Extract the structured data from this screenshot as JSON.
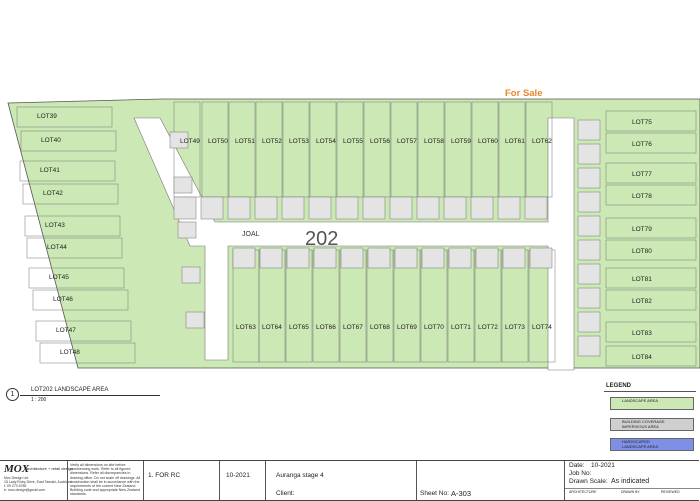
{
  "sale_label": "For Sale",
  "site_number": "202",
  "joal_label": "JOAL",
  "lots": [
    {
      "label": "LOT39"
    },
    {
      "label": "LOT40"
    },
    {
      "label": "LOT41"
    },
    {
      "label": "LOT42"
    },
    {
      "label": "LOT43"
    },
    {
      "label": "LOT44"
    },
    {
      "label": "LOT45"
    },
    {
      "label": "LOT46"
    },
    {
      "label": "LOT47"
    },
    {
      "label": "LOT48"
    },
    {
      "label": "LOT49"
    },
    {
      "label": "LOT50"
    },
    {
      "label": "LOT51"
    },
    {
      "label": "LOT52"
    },
    {
      "label": "LOT53"
    },
    {
      "label": "LOT54"
    },
    {
      "label": "LOT55"
    },
    {
      "label": "LOT56"
    },
    {
      "label": "LOT57"
    },
    {
      "label": "LOT58"
    },
    {
      "label": "LOT59"
    },
    {
      "label": "LOT60"
    },
    {
      "label": "LOT61"
    },
    {
      "label": "LOT62"
    },
    {
      "label": "LOT63"
    },
    {
      "label": "LOT64"
    },
    {
      "label": "LOT65"
    },
    {
      "label": "LOT66"
    },
    {
      "label": "LOT67"
    },
    {
      "label": "LOT68"
    },
    {
      "label": "LOT69"
    },
    {
      "label": "LOT70"
    },
    {
      "label": "LOT71"
    },
    {
      "label": "LOT72"
    },
    {
      "label": "LOT73"
    },
    {
      "label": "LOT74"
    },
    {
      "label": "LOT75"
    },
    {
      "label": "LOT76"
    },
    {
      "label": "LOT77"
    },
    {
      "label": "LOT78"
    },
    {
      "label": "LOT79"
    },
    {
      "label": "LOT80"
    },
    {
      "label": "LOT81"
    },
    {
      "label": "LOT82"
    },
    {
      "label": "LOT83"
    },
    {
      "label": "LOT84"
    }
  ],
  "drawing_caption": {
    "number": "1",
    "title": "LOT202 LANDSCAPE AREA",
    "scale": "1 : 200"
  },
  "legend": {
    "title": "LEGEND",
    "items": [
      {
        "label": "LANDSCAPE AREA",
        "color": "#cce8b5"
      },
      {
        "label": "BUILDING COVERAGE\nIMPERVIOUS AREA",
        "color": "#cfcfcf"
      },
      {
        "label": "HARDSCAPED\nLANDSCAPE AREA",
        "color": "#7f8fe6"
      }
    ]
  },
  "title_block": {
    "logo": "MOX",
    "logo_sub": "architecture + retail design",
    "company_lines": [
      "Mox Design Ltd",
      "15 Lady Ruby Drive, East Tamaki, Auckland",
      "t: 09 273 6789",
      "e: mox.design@gmail.com"
    ],
    "notes": "Verify all dimensions on site before commencing work. Refer to all figured dimensions. Refer all discrepancies in drawing office. Do not scale off drawings. All construction shall be in accordance with the requirements of the current New Zealand Building code and appropriate New Zealand standards.",
    "revision": "1. FOR RC",
    "revision_date": "10-2021",
    "project": "Auranga stage 4",
    "client_label": "Client:",
    "sheet_label": "Sheet No:",
    "sheet_no": "A-303",
    "date_label": "Date:",
    "date_value": "10-2021",
    "job_label": "Job No:",
    "scale_label": "Drawn Scale:",
    "scale_value": "As indicated",
    "discipline": "ARCHITECTURE",
    "drawn_by": "DRAWN BY",
    "reviewed": "REVIEWED"
  }
}
